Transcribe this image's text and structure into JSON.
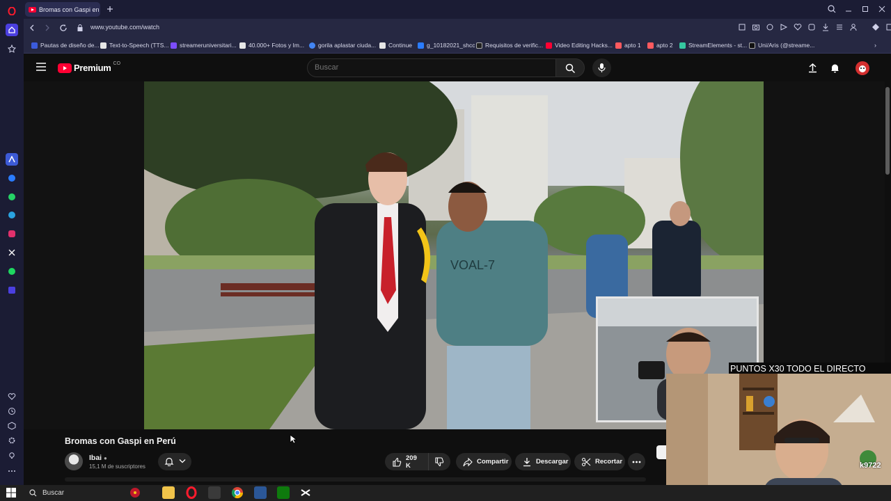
{
  "browser": {
    "tab_title": "Bromas con Gaspi en",
    "url": "www.youtube.com/watch"
  },
  "bookmarks": [
    "Pautas de diseño de...",
    "Text-to-Speech (TTS...",
    "streameruniversitari...",
    "40.000+ Fotos y Im...",
    "gorila aplastar ciuda...",
    "Continue",
    "g_10182021_shcc",
    "Requisitos de verific...",
    "Video Editing Hacks...",
    "apto 1",
    "apto 2",
    "StreamElements - st...",
    "Uni/Aris (@streame..."
  ],
  "youtube": {
    "logo_text": "Premium",
    "country_code": "CO",
    "search_placeholder": "Buscar"
  },
  "video": {
    "title": "Bromas con Gaspi en Perú",
    "channel": "Ibai",
    "subscribers": "15,1 M de suscriptores",
    "likes": "209 K",
    "share_label": "Compartir",
    "download_label": "Descargar",
    "clip_label": "Recortar",
    "shirt_text": "VOAL-7"
  },
  "stream_overlay": {
    "banner": "PUNTOS X30 TODO EL DIRECTO",
    "badge": "k9722"
  },
  "taskbar": {
    "search_label": "Buscar"
  }
}
